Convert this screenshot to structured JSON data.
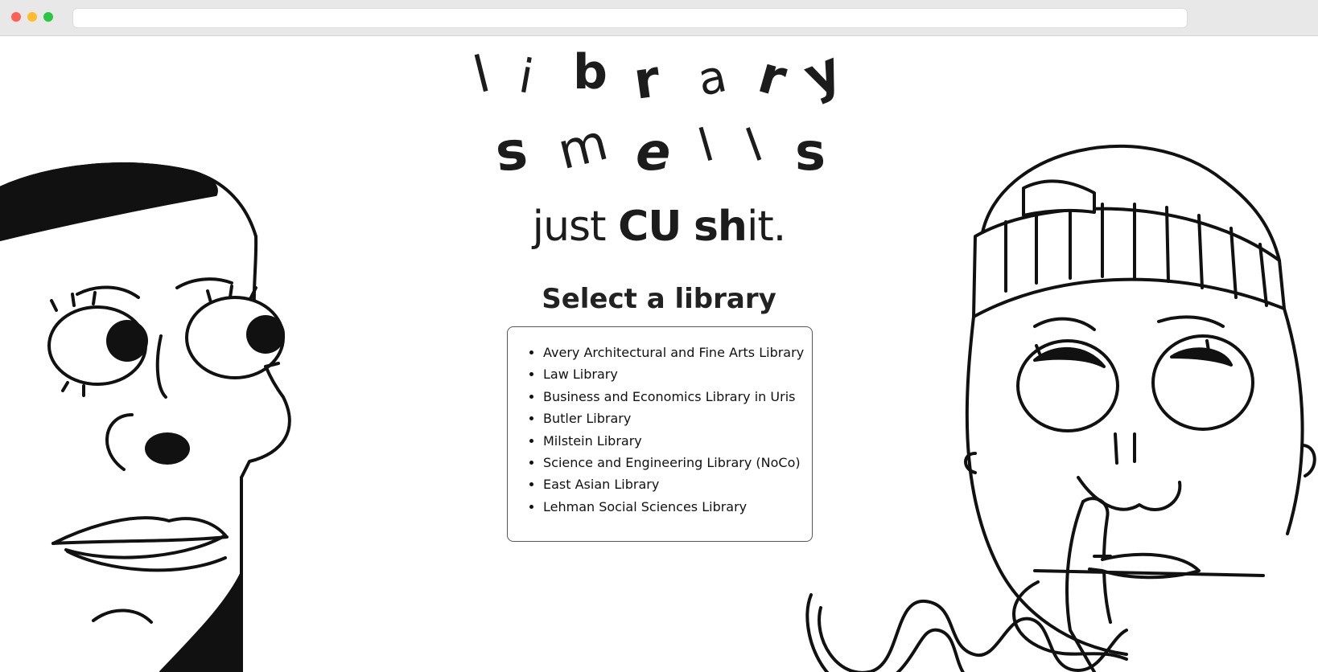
{
  "browser": {
    "controls": [
      "close-icon",
      "minimize-icon",
      "maximize-icon"
    ],
    "address": ""
  },
  "header": {
    "word1": [
      "l",
      "i",
      "b",
      "r",
      "a",
      "r",
      "y"
    ],
    "word2": [
      "s",
      "m",
      "e",
      "l",
      "l",
      "s"
    ],
    "tagline": {
      "part1": "just ",
      "part2": "CU",
      "part3": " ",
      "part4": "sh",
      "part5": "it."
    }
  },
  "main": {
    "heading": "Select a library",
    "libraries": [
      "Avery Architectural and Fine Arts Library",
      "Law Library",
      "Business and Economics Library in Uris",
      "Butler Library",
      "Milstein Library",
      "Science and Engineering Library (NoCo)",
      "East Asian Library",
      "Lehman Social Sciences Library"
    ]
  },
  "colors": {
    "ink": "#1c1c1c",
    "chrome": "#e8e8e8",
    "background": "#ffffff"
  }
}
